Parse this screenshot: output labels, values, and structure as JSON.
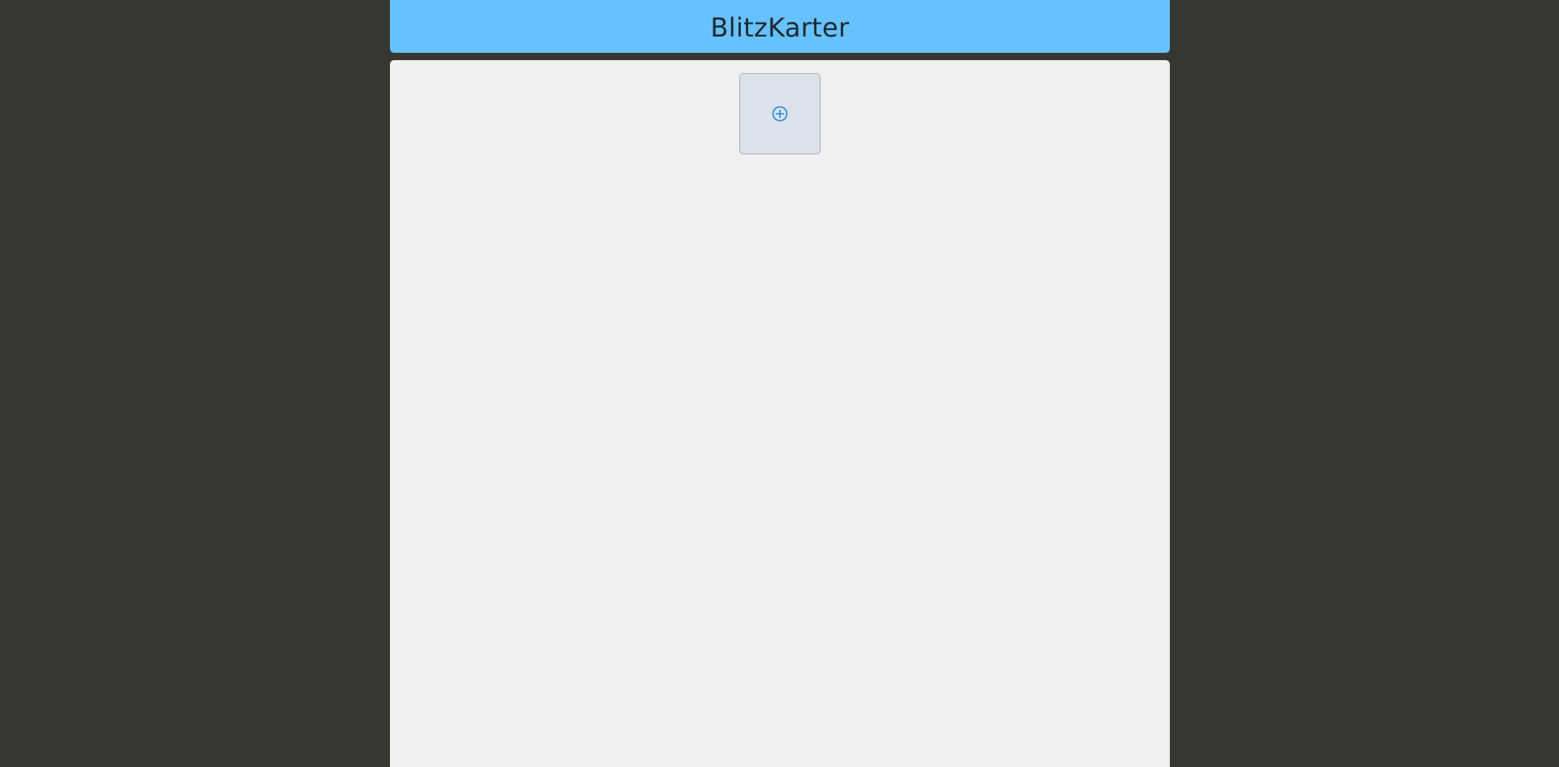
{
  "header": {
    "title": "BlitzKarter"
  },
  "board": {
    "add_card_icon": "plus-circle-icon"
  },
  "colors": {
    "background": "#363632",
    "header": "#66c2ff",
    "board": "#f0f0f0",
    "add_card": "#dde1e9",
    "icon_accent": "#1a8cd8"
  }
}
